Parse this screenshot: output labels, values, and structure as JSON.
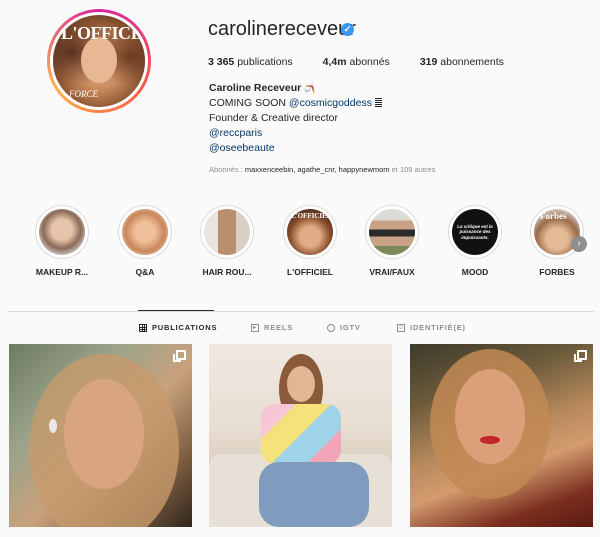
{
  "profile": {
    "username": "carolinereceveur",
    "verified": true,
    "avatar_text": "L'OFFICIEL",
    "avatar_subtext": "FORCE",
    "stats": {
      "posts_value": "3 365",
      "posts_label": "publications",
      "followers_value": "4,4m",
      "followers_label": "abonnés",
      "following_value": "319",
      "following_label": "abonnements"
    },
    "full_name": "Caroline Receveur",
    "bio": {
      "line1_prefix": "COMING SOON ",
      "line1_link": "@cosmicgoddess",
      "line2": "Founder & Creative director",
      "line3_link": "@reccparis",
      "line4_link": "@oseebeaute"
    },
    "followed_by": {
      "prefix": "Abonnés : ",
      "names": "maxxenceebin, agathe_cnr, happynewmom",
      "suffix": " et 109 autres"
    }
  },
  "highlights": [
    {
      "label": "MAKEUP R...",
      "color": "#c9a58a"
    },
    {
      "label": "Q&A",
      "color": "#e0a77e"
    },
    {
      "label": "HAIR ROU...",
      "color": "#b89a84"
    },
    {
      "label": "L'OFFICIEL",
      "color": "#b7774e"
    },
    {
      "label": "VRAI/FAUX",
      "color": "#5f6a4f"
    },
    {
      "label": "MOOD",
      "color": "#111111"
    },
    {
      "label": "FORBES",
      "color": "#c8a07c"
    }
  ],
  "mood_text": "La critique est la puissance des impuissants.",
  "forbes_text": "Forbes",
  "tabs": [
    {
      "label": "PUBLICATIONS",
      "icon": "grid-icon",
      "active": true
    },
    {
      "label": "REELS",
      "icon": "reels-icon",
      "active": false
    },
    {
      "label": "IGTV",
      "icon": "igtv-icon",
      "active": false
    },
    {
      "label": "IDENTIFIÉ(E)",
      "icon": "tagged-icon",
      "active": false
    }
  ],
  "colors": {
    "link": "#00376b",
    "verified": "#3897f0",
    "muted": "#8e8e8e"
  }
}
